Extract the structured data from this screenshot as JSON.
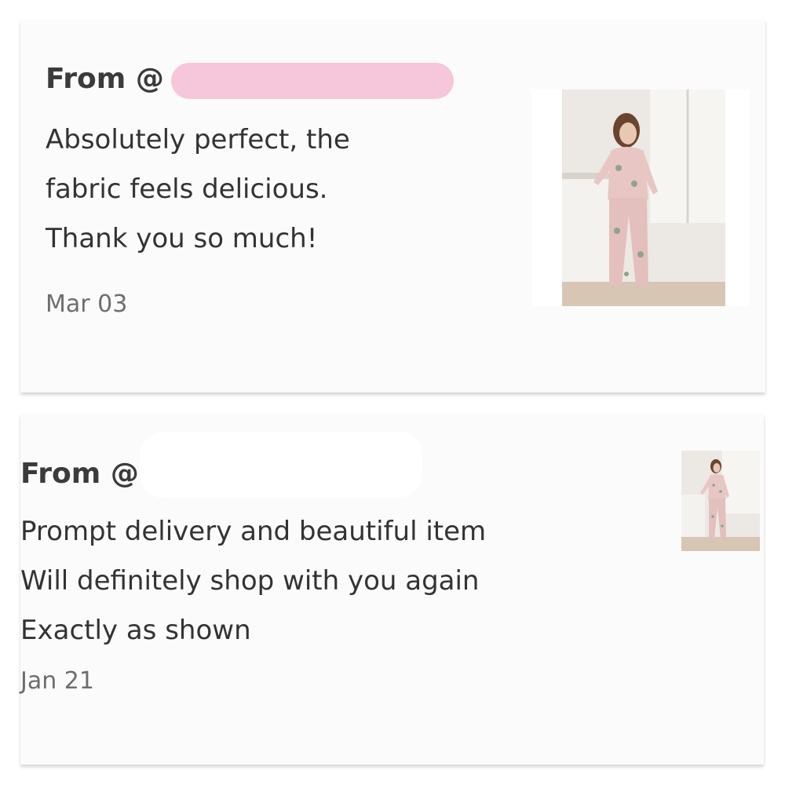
{
  "reviews": [
    {
      "from_label": "From @",
      "lines": [
        "Absolutely perfect, the",
        "fabric feels delicious.",
        "Thank you so much!"
      ],
      "date": "Mar 03",
      "redaction_color": "#f6c6da"
    },
    {
      "from_label": "From @",
      "lines": [
        "Prompt delivery and beautiful item",
        "Will definitely shop with you again",
        "Exactly as shown"
      ],
      "date": "Jan 21",
      "redaction_color": "#ffffff"
    }
  ],
  "colors": {
    "card_bg": "#fcfbfc",
    "text": "#333333",
    "date_text": "#6e6e6e",
    "pajama_pink": "#e8c6c4"
  },
  "icons": {
    "product_thumbnail": "pink-satin-pajama-photo"
  }
}
